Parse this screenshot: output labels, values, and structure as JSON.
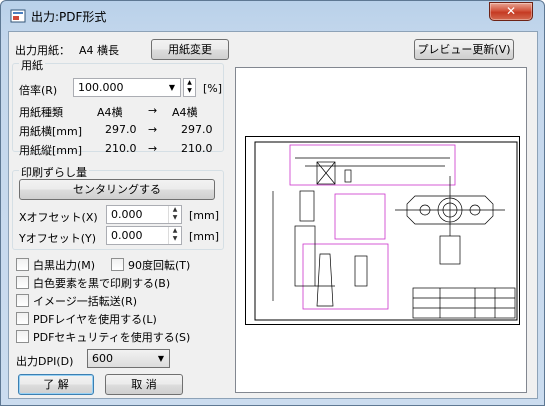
{
  "window": {
    "title": "出力:PDF形式",
    "close_glyph": "✕"
  },
  "paper": {
    "output_paper_label": "出力用紙：",
    "output_paper_value": "A4 横長",
    "change_button": "用紙変更",
    "preview_update_button": "プレビュー更新(V)",
    "group_title": "用紙",
    "scale_label": "倍率(R)",
    "scale_value": "100.000",
    "scale_unit": "[%]",
    "rows": [
      {
        "label": "用紙種類",
        "from": "A4横",
        "arrow": "→",
        "to": "A4横"
      },
      {
        "label": "用紙横[mm]",
        "from": "297.0",
        "arrow": "→",
        "to": "297.0"
      },
      {
        "label": "用紙縦[mm]",
        "from": "210.0",
        "arrow": "→",
        "to": "210.0"
      }
    ]
  },
  "offset": {
    "group_title": "印刷ずらし量",
    "center_button": "センタリングする",
    "x_label": "Xオフセット(X)",
    "x_value": "0.000",
    "y_label": "Yオフセット(Y)",
    "y_value": "0.000",
    "unit": "[mm]"
  },
  "options": {
    "mono": "白黒出力(M)",
    "rotate90": "90度回転(T)",
    "white_as_black": "白色要素を黒で印刷する(B)",
    "image_batch": "イメージ一括転送(R)",
    "pdf_layer": "PDFレイヤを使用する(L)",
    "pdf_security": "PDFセキュリティを使用する(S)"
  },
  "dpi": {
    "label": "出力DPI(D)",
    "value": "600"
  },
  "actions": {
    "ok": "了 解",
    "cancel": "取 消"
  },
  "colors": {
    "drawing_line": "#000000",
    "layout_box": "#cc33cc"
  }
}
